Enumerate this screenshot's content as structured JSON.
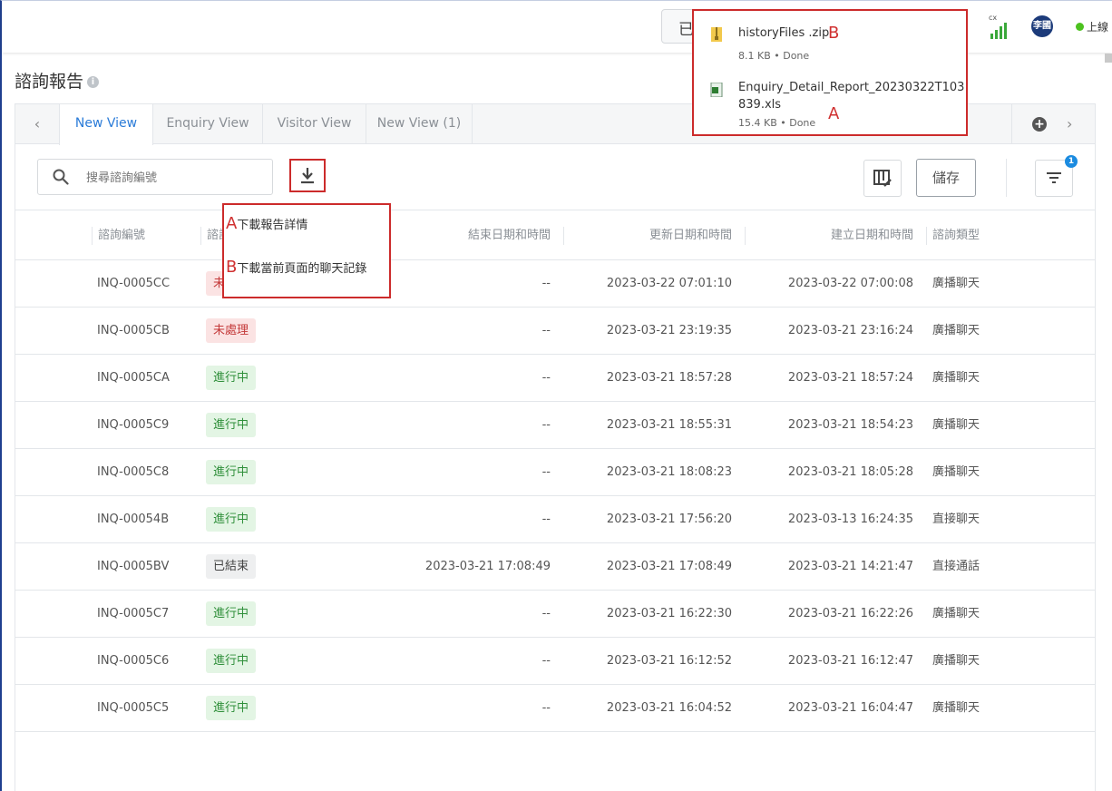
{
  "topbar": {
    "partial_button": "已",
    "signal_label": "cx",
    "avatar_text": "李國",
    "status": "上線"
  },
  "page": {
    "title": "諮詢報告",
    "info_icon": "i"
  },
  "tabs": [
    {
      "label": "New View"
    },
    {
      "label": "Enquiry View"
    },
    {
      "label": "Visitor View"
    },
    {
      "label": "New View (1)"
    }
  ],
  "toolbar": {
    "search_placeholder": "搜尋諮詢編號",
    "save_label": "儲存",
    "filter_badge": "1"
  },
  "table": {
    "headers": [
      "諮詢編號",
      "諮詢",
      "結束日期和時間",
      "更新日期和時間",
      "建立日期和時間",
      "諮詢類型"
    ],
    "rows": [
      {
        "id": "INQ-0005CC",
        "status": "未處理",
        "kind": "pending",
        "end": "--",
        "updated": "2023-03-22 07:01:10",
        "created": "2023-03-22 07:00:08",
        "type": "廣播聊天"
      },
      {
        "id": "INQ-0005CB",
        "status": "未處理",
        "kind": "pending",
        "end": "--",
        "updated": "2023-03-21 23:19:35",
        "created": "2023-03-21 23:16:24",
        "type": "廣播聊天"
      },
      {
        "id": "INQ-0005CA",
        "status": "進行中",
        "kind": "progress",
        "end": "--",
        "updated": "2023-03-21 18:57:28",
        "created": "2023-03-21 18:57:24",
        "type": "廣播聊天"
      },
      {
        "id": "INQ-0005C9",
        "status": "進行中",
        "kind": "progress",
        "end": "--",
        "updated": "2023-03-21 18:55:31",
        "created": "2023-03-21 18:54:23",
        "type": "廣播聊天"
      },
      {
        "id": "INQ-0005C8",
        "status": "進行中",
        "kind": "progress",
        "end": "--",
        "updated": "2023-03-21 18:08:23",
        "created": "2023-03-21 18:05:28",
        "type": "廣播聊天"
      },
      {
        "id": "INQ-00054B",
        "status": "進行中",
        "kind": "progress",
        "end": "--",
        "updated": "2023-03-21 17:56:20",
        "created": "2023-03-13 16:24:35",
        "type": "直接聊天"
      },
      {
        "id": "INQ-0005BV",
        "status": "已結束",
        "kind": "ended",
        "end": "2023-03-21 17:08:49",
        "updated": "2023-03-21 17:08:49",
        "created": "2023-03-21 14:21:47",
        "type": "直接通話"
      },
      {
        "id": "INQ-0005C7",
        "status": "進行中",
        "kind": "progress",
        "end": "--",
        "updated": "2023-03-21 16:22:30",
        "created": "2023-03-21 16:22:26",
        "type": "廣播聊天"
      },
      {
        "id": "INQ-0005C6",
        "status": "進行中",
        "kind": "progress",
        "end": "--",
        "updated": "2023-03-21 16:12:52",
        "created": "2023-03-21 16:12:47",
        "type": "廣播聊天"
      },
      {
        "id": "INQ-0005C5",
        "status": "進行中",
        "kind": "progress",
        "end": "--",
        "updated": "2023-03-21 16:04:52",
        "created": "2023-03-21 16:04:47",
        "type": "廣播聊天"
      }
    ]
  },
  "download_menu": {
    "item_a_letter": "A",
    "item_a": "下載報告詳情",
    "item_b_letter": "B",
    "item_b": "下載當前頁面的聊天記錄"
  },
  "downloads": {
    "file_b_name": "historyFiles .zip",
    "file_b_letter": "B",
    "file_b_meta": "8.1 KB • Done",
    "file_a_name_line1": "Enquiry_Detail_Report_20230322T103",
    "file_a_name_line2": "839.xls",
    "file_a_letter": "A",
    "file_a_meta": "15.4 KB • Done"
  },
  "colors": {
    "accent": "#2a7bd8",
    "annotation": "#cc2b2b",
    "online": "#4cc21f",
    "badge": "#1b8be0"
  }
}
